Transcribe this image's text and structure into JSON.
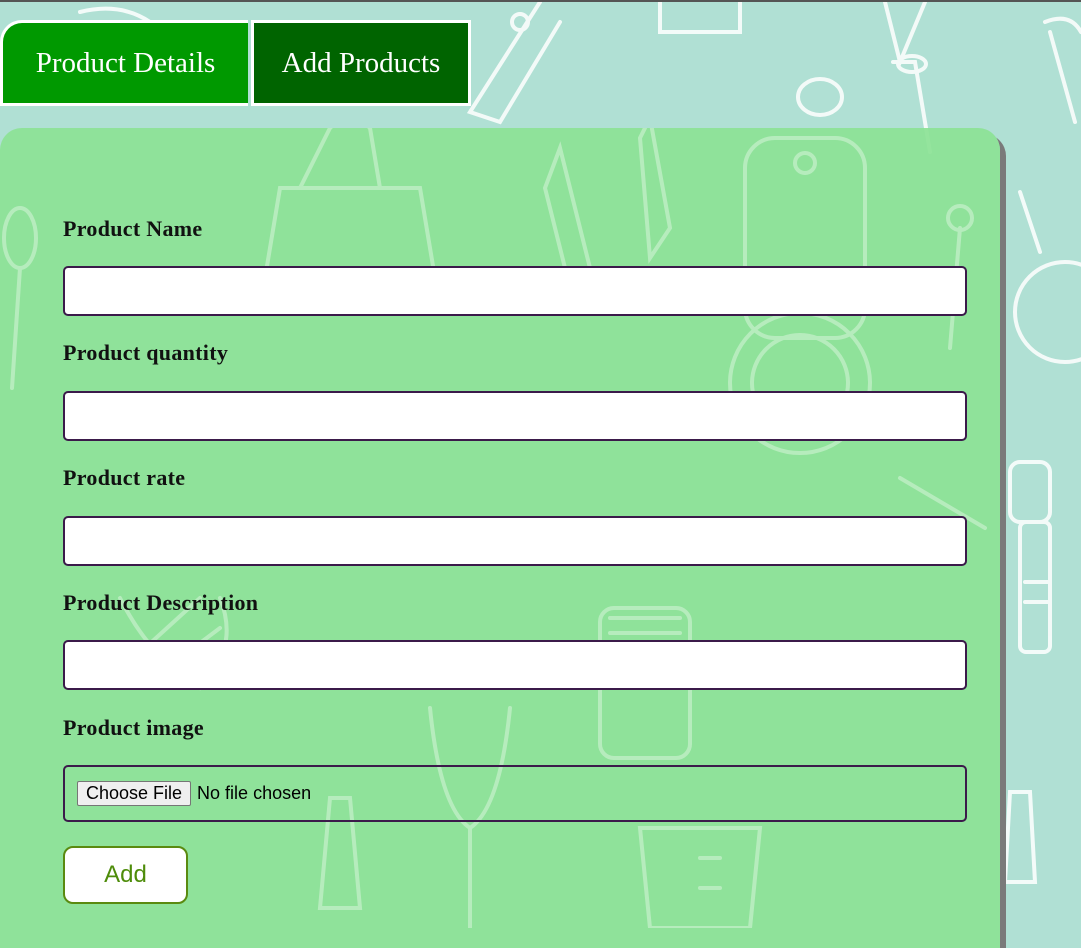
{
  "tabs": {
    "details_label": "Product Details",
    "add_label": "Add Products"
  },
  "form": {
    "name_label": "Product Name",
    "quantity_label": "Product quantity",
    "rate_label": "Product rate",
    "description_label": "Product Description",
    "image_label": "Product image",
    "choose_file_label": "Choose File",
    "file_status": "No file chosen",
    "add_label": "Add"
  },
  "colors": {
    "page_bg": "#b0e0d4",
    "tab_active": "#009900",
    "tab_inactive": "#006400",
    "panel_bg": "#8ce296",
    "input_border": "#3b1a4a",
    "add_button_text": "#4e8c0a"
  }
}
